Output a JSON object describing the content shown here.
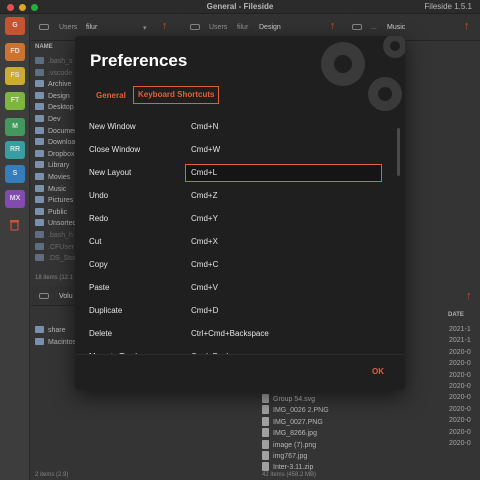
{
  "window": {
    "title": "General - Fileside",
    "app_version": "Fileside 1.5.1"
  },
  "colors": {
    "accent": "#e25f3a",
    "modal_bg": "#1f1f1f",
    "window_bg": "#3c3c3c"
  },
  "sidebar": {
    "favorites": [
      {
        "label": "G",
        "color": "#e25f3a"
      },
      {
        "label": "FD",
        "color": "#e8853a"
      },
      {
        "label": "FS",
        "color": "#e6c43c"
      },
      {
        "label": "FT",
        "color": "#8fcf4a"
      },
      {
        "label": "M",
        "color": "#4cae6a"
      },
      {
        "label": "RR",
        "color": "#3fb6b8"
      },
      {
        "label": "S",
        "color": "#3d8fd6"
      },
      {
        "label": "MX",
        "color": "#9656c8"
      }
    ],
    "trash_icon": "trash-icon"
  },
  "pane_left_top": {
    "breadcrumb": [
      "Users",
      "filur"
    ],
    "column_header": "NAME",
    "files": [
      ".bash_s",
      ".vscode",
      "Archive",
      "Design",
      "Desktop",
      "Dev",
      "Documen",
      "Downloa",
      "Dropbox",
      "Library",
      "Movies",
      "Music",
      "Pictures",
      "Public",
      "Unsorted",
      ".bash_h",
      ".CFUser",
      ".DS_Stor"
    ],
    "status": "18 items (12.1"
  },
  "pane_left_bottom": {
    "breadcrumb": "Volu",
    "files": [
      "share",
      "Macintos"
    ],
    "status": "2 items (2.9)"
  },
  "pane_middle_top": {
    "breadcrumb": [
      "Users",
      "filur",
      "Design"
    ]
  },
  "pane_right_top": {
    "breadcrumb": [
      "...",
      "Music"
    ]
  },
  "pane_right_bottom": {
    "column_header": "DATE",
    "dates": [
      "2021-1",
      "2021-1",
      "2020-0",
      "2020-0",
      "2020-0",
      "2020-0",
      "2020-0",
      "2020-0",
      "2020-0",
      "2020-0",
      "2020-0"
    ]
  },
  "pane_middle_bottom": {
    "files": [
      "Group 54.svg",
      "IMG_0026 2.PNG",
      "IMG_0027.PNG",
      "IMG_8266.jpg",
      "image (7).png",
      "img767.jpg",
      "Inter-3.11.zip"
    ],
    "status": "42 items (458.2 MB)"
  },
  "preferences": {
    "title": "Preferences",
    "tabs": {
      "general": "General",
      "keyboard": "Keyboard Shortcuts"
    },
    "shortcuts": [
      {
        "action": "New Window",
        "keys": "Cmd+N"
      },
      {
        "action": "Close Window",
        "keys": "Cmd+W"
      },
      {
        "action": "New Layout",
        "keys": "Cmd+L",
        "active": true
      },
      {
        "action": "Undo",
        "keys": "Cmd+Z"
      },
      {
        "action": "Redo",
        "keys": "Cmd+Y"
      },
      {
        "action": "Cut",
        "keys": "Cmd+X"
      },
      {
        "action": "Copy",
        "keys": "Cmd+C"
      },
      {
        "action": "Paste",
        "keys": "Cmd+V"
      },
      {
        "action": "Duplicate",
        "keys": "Cmd+D"
      },
      {
        "action": "Delete",
        "keys": "Ctrl+Cmd+Backspace"
      },
      {
        "action": "Move to Trash",
        "keys": "Cmd+Backspace"
      }
    ],
    "ok_label": "OK"
  }
}
